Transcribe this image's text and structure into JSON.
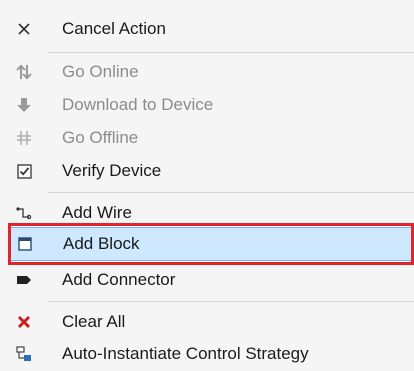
{
  "menu": {
    "items": [
      {
        "label": "Cancel Action",
        "icon": "close-icon",
        "enabled": true
      },
      {
        "label": "Go Online",
        "icon": "go-online-icon",
        "enabled": false
      },
      {
        "label": "Download to Device",
        "icon": "download-icon",
        "enabled": false
      },
      {
        "label": "Go Offline",
        "icon": "go-offline-icon",
        "enabled": false
      },
      {
        "label": "Verify Device",
        "icon": "checkbox-icon",
        "enabled": true
      },
      {
        "label": "Add Wire",
        "icon": "wire-icon",
        "enabled": true
      },
      {
        "label": "Add Block",
        "icon": "block-icon",
        "enabled": true,
        "highlighted": true
      },
      {
        "label": "Add Connector",
        "icon": "connector-icon",
        "enabled": true
      },
      {
        "label": "Clear All",
        "icon": "clear-icon",
        "enabled": true
      },
      {
        "label": "Auto-Instantiate Control Strategy",
        "icon": "auto-instantiate-icon",
        "enabled": true
      }
    ]
  },
  "colors": {
    "highlight_bg": "#cde8ff",
    "focus_outline": "#e3242b",
    "disabled_text": "#8c8c8c",
    "clear_icon": "#cc1f1f"
  }
}
